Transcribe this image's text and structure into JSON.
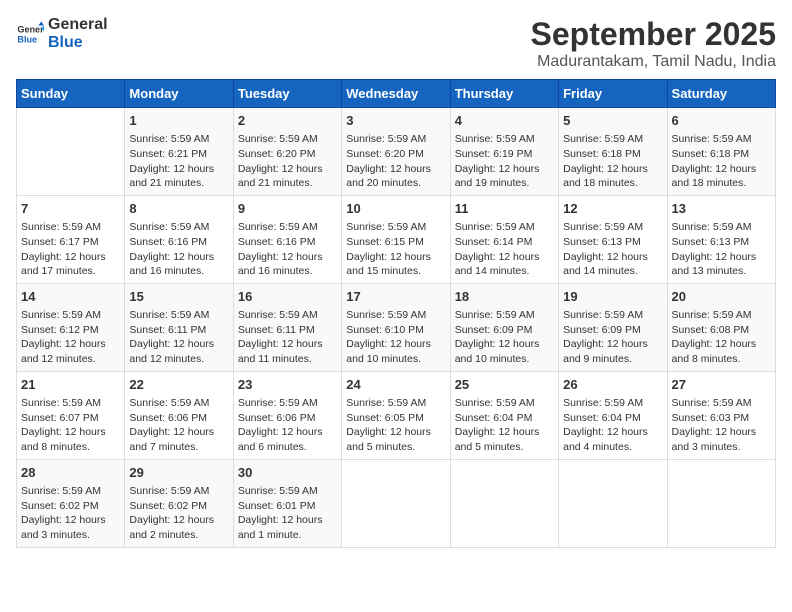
{
  "header": {
    "logo_line1": "General",
    "logo_line2": "Blue",
    "title": "September 2025",
    "subtitle": "Madurantakam, Tamil Nadu, India"
  },
  "days_of_week": [
    "Sunday",
    "Monday",
    "Tuesday",
    "Wednesday",
    "Thursday",
    "Friday",
    "Saturday"
  ],
  "weeks": [
    [
      {
        "day": "",
        "info": ""
      },
      {
        "day": "1",
        "info": "Sunrise: 5:59 AM\nSunset: 6:21 PM\nDaylight: 12 hours\nand 21 minutes."
      },
      {
        "day": "2",
        "info": "Sunrise: 5:59 AM\nSunset: 6:20 PM\nDaylight: 12 hours\nand 21 minutes."
      },
      {
        "day": "3",
        "info": "Sunrise: 5:59 AM\nSunset: 6:20 PM\nDaylight: 12 hours\nand 20 minutes."
      },
      {
        "day": "4",
        "info": "Sunrise: 5:59 AM\nSunset: 6:19 PM\nDaylight: 12 hours\nand 19 minutes."
      },
      {
        "day": "5",
        "info": "Sunrise: 5:59 AM\nSunset: 6:18 PM\nDaylight: 12 hours\nand 18 minutes."
      },
      {
        "day": "6",
        "info": "Sunrise: 5:59 AM\nSunset: 6:18 PM\nDaylight: 12 hours\nand 18 minutes."
      }
    ],
    [
      {
        "day": "7",
        "info": "Sunrise: 5:59 AM\nSunset: 6:17 PM\nDaylight: 12 hours\nand 17 minutes."
      },
      {
        "day": "8",
        "info": "Sunrise: 5:59 AM\nSunset: 6:16 PM\nDaylight: 12 hours\nand 16 minutes."
      },
      {
        "day": "9",
        "info": "Sunrise: 5:59 AM\nSunset: 6:16 PM\nDaylight: 12 hours\nand 16 minutes."
      },
      {
        "day": "10",
        "info": "Sunrise: 5:59 AM\nSunset: 6:15 PM\nDaylight: 12 hours\nand 15 minutes."
      },
      {
        "day": "11",
        "info": "Sunrise: 5:59 AM\nSunset: 6:14 PM\nDaylight: 12 hours\nand 14 minutes."
      },
      {
        "day": "12",
        "info": "Sunrise: 5:59 AM\nSunset: 6:13 PM\nDaylight: 12 hours\nand 14 minutes."
      },
      {
        "day": "13",
        "info": "Sunrise: 5:59 AM\nSunset: 6:13 PM\nDaylight: 12 hours\nand 13 minutes."
      }
    ],
    [
      {
        "day": "14",
        "info": "Sunrise: 5:59 AM\nSunset: 6:12 PM\nDaylight: 12 hours\nand 12 minutes."
      },
      {
        "day": "15",
        "info": "Sunrise: 5:59 AM\nSunset: 6:11 PM\nDaylight: 12 hours\nand 12 minutes."
      },
      {
        "day": "16",
        "info": "Sunrise: 5:59 AM\nSunset: 6:11 PM\nDaylight: 12 hours\nand 11 minutes."
      },
      {
        "day": "17",
        "info": "Sunrise: 5:59 AM\nSunset: 6:10 PM\nDaylight: 12 hours\nand 10 minutes."
      },
      {
        "day": "18",
        "info": "Sunrise: 5:59 AM\nSunset: 6:09 PM\nDaylight: 12 hours\nand 10 minutes."
      },
      {
        "day": "19",
        "info": "Sunrise: 5:59 AM\nSunset: 6:09 PM\nDaylight: 12 hours\nand 9 minutes."
      },
      {
        "day": "20",
        "info": "Sunrise: 5:59 AM\nSunset: 6:08 PM\nDaylight: 12 hours\nand 8 minutes."
      }
    ],
    [
      {
        "day": "21",
        "info": "Sunrise: 5:59 AM\nSunset: 6:07 PM\nDaylight: 12 hours\nand 8 minutes."
      },
      {
        "day": "22",
        "info": "Sunrise: 5:59 AM\nSunset: 6:06 PM\nDaylight: 12 hours\nand 7 minutes."
      },
      {
        "day": "23",
        "info": "Sunrise: 5:59 AM\nSunset: 6:06 PM\nDaylight: 12 hours\nand 6 minutes."
      },
      {
        "day": "24",
        "info": "Sunrise: 5:59 AM\nSunset: 6:05 PM\nDaylight: 12 hours\nand 5 minutes."
      },
      {
        "day": "25",
        "info": "Sunrise: 5:59 AM\nSunset: 6:04 PM\nDaylight: 12 hours\nand 5 minutes."
      },
      {
        "day": "26",
        "info": "Sunrise: 5:59 AM\nSunset: 6:04 PM\nDaylight: 12 hours\nand 4 minutes."
      },
      {
        "day": "27",
        "info": "Sunrise: 5:59 AM\nSunset: 6:03 PM\nDaylight: 12 hours\nand 3 minutes."
      }
    ],
    [
      {
        "day": "28",
        "info": "Sunrise: 5:59 AM\nSunset: 6:02 PM\nDaylight: 12 hours\nand 3 minutes."
      },
      {
        "day": "29",
        "info": "Sunrise: 5:59 AM\nSunset: 6:02 PM\nDaylight: 12 hours\nand 2 minutes."
      },
      {
        "day": "30",
        "info": "Sunrise: 5:59 AM\nSunset: 6:01 PM\nDaylight: 12 hours\nand 1 minute."
      },
      {
        "day": "",
        "info": ""
      },
      {
        "day": "",
        "info": ""
      },
      {
        "day": "",
        "info": ""
      },
      {
        "day": "",
        "info": ""
      }
    ]
  ]
}
